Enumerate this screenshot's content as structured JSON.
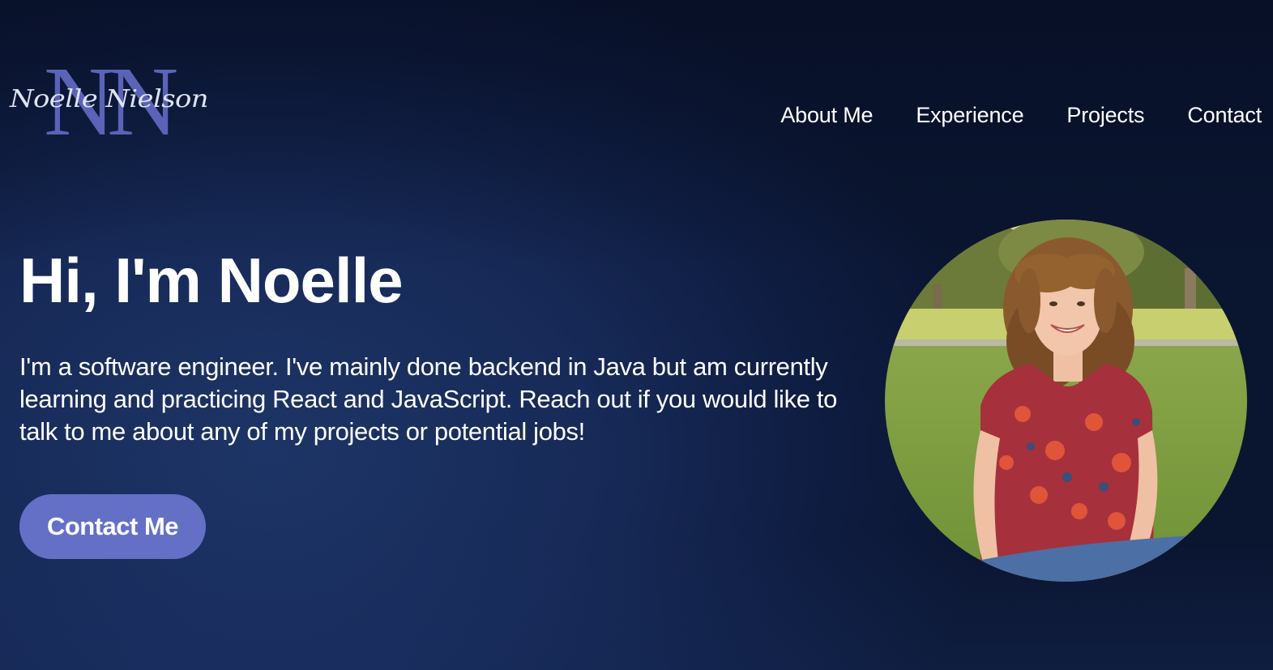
{
  "logo": {
    "monogram": "NN",
    "script_name": "Noelle Nielson",
    "monogram_color": "#5b63b8"
  },
  "nav": {
    "items": [
      {
        "label": "About Me"
      },
      {
        "label": "Experience"
      },
      {
        "label": "Projects"
      },
      {
        "label": "Contact"
      }
    ]
  },
  "hero": {
    "title": "Hi, I'm Noelle",
    "intro": "I'm a software engineer. I've mainly done backend in Java but am currently learning and practicing React and JavaScript. Reach out if you would like to talk to me about any of my projects or potential jobs!",
    "cta_label": "Contact Me",
    "cta_color": "#6470c5"
  },
  "colors": {
    "background_dark": "#0a1530",
    "background_mid": "#1d3566",
    "text": "#ffffff"
  }
}
